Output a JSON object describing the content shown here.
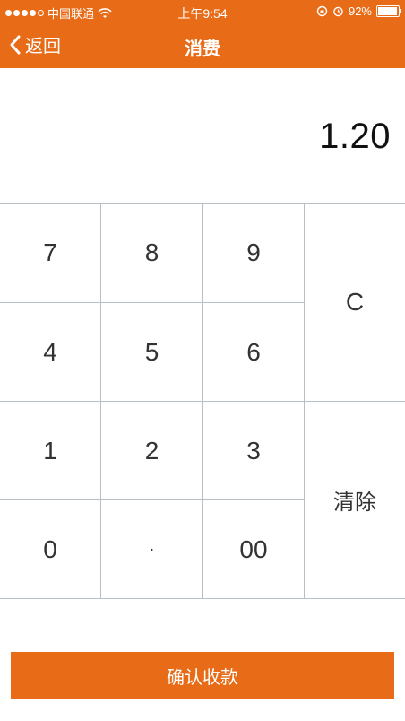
{
  "status_bar": {
    "carrier": "中国联通",
    "time": "上午9:54",
    "battery": "92%",
    "battery_level": 0.92
  },
  "nav": {
    "back_label": "返回",
    "title": "消费"
  },
  "amount": "1.20",
  "keypad": {
    "keys": [
      "7",
      "8",
      "9",
      "4",
      "5",
      "6",
      "1",
      "2",
      "3",
      "0",
      "·",
      "00"
    ],
    "clear_entry": "C",
    "clear_all": "清除"
  },
  "confirm_label": "确认收款",
  "colors": {
    "accent": "#e86b17",
    "grid": "#b7bec4"
  }
}
